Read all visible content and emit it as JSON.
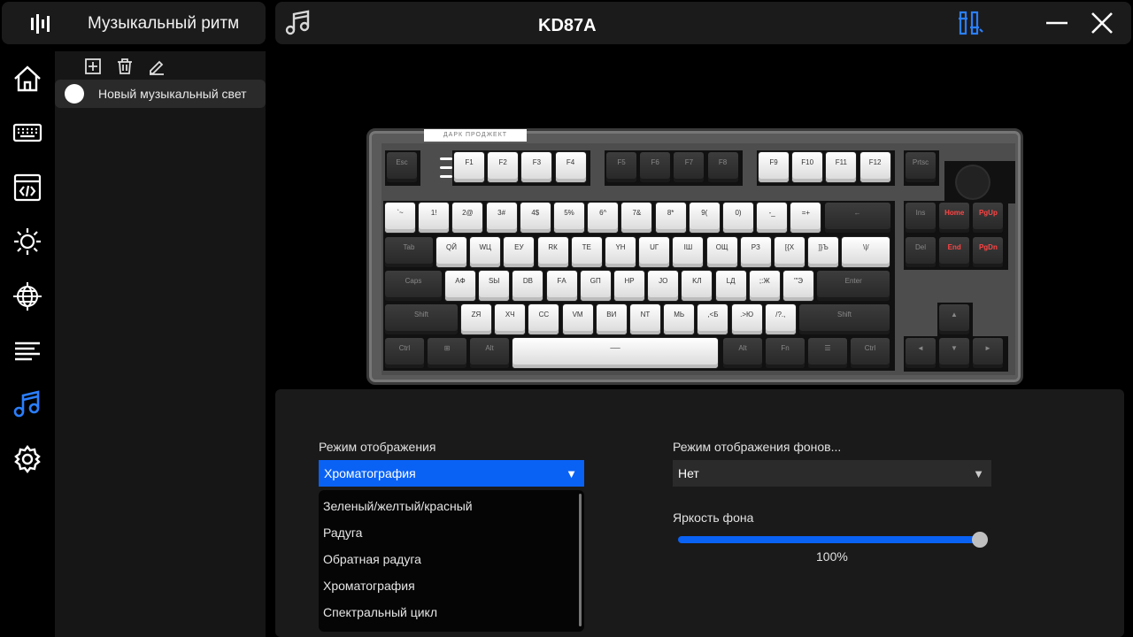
{
  "app": {
    "title": "Музыкальный ритм"
  },
  "header": {
    "device": "KD87A"
  },
  "nav": [
    {
      "icon": "home-icon"
    },
    {
      "icon": "keyboard-icon"
    },
    {
      "icon": "macro-code-icon"
    },
    {
      "icon": "lighting-icon"
    },
    {
      "icon": "globe-icon"
    },
    {
      "icon": "align-lines-icon"
    },
    {
      "icon": "music-notes-icon",
      "active": true
    },
    {
      "icon": "gear-icon"
    }
  ],
  "list": {
    "tools": [
      "add-icon",
      "trash-icon",
      "edit-icon"
    ],
    "items": [
      {
        "label": "Новый музыкальный свет"
      }
    ]
  },
  "keyboard": {
    "brand": "ДАРК ПРОДЖЕКТ",
    "rows": {
      "fn": [
        "Esc",
        "F1",
        "F2",
        "F3",
        "F4",
        "F5",
        "F6",
        "F7",
        "F8",
        "F9",
        "F10",
        "F11",
        "F12",
        "Prtsc"
      ],
      "num": [
        "`~",
        "1!",
        "2@",
        "3#",
        "4$",
        "5%",
        "6^",
        "7&",
        "8*",
        "9(",
        "0)",
        "-_",
        "=+",
        "←"
      ],
      "q": [
        "Tab",
        "QЙ",
        "WЦ",
        "EУ",
        "RК",
        "TЕ",
        "YН",
        "UГ",
        "IШ",
        "OЩ",
        "PЗ",
        "[{Х",
        "]}Ъ",
        "\\|/"
      ],
      "a": [
        "Caps",
        "AФ",
        "SЫ",
        "DВ",
        "FА",
        "GП",
        "HР",
        "JО",
        "KЛ",
        "LД",
        ";:Ж",
        "'\"Э",
        "Enter"
      ],
      "z": [
        "Shift",
        "ZЯ",
        "XЧ",
        "CС",
        "VМ",
        "BИ",
        "NТ",
        "MЬ",
        ",<Б",
        ".>Ю",
        "/?.,",
        "Shift"
      ],
      "bottom": [
        "Ctrl",
        "⊞",
        "Alt",
        "──",
        "Alt",
        "Fn",
        "☰",
        "Ctrl"
      ],
      "nav1": [
        "Ins",
        "Home",
        "PgUp"
      ],
      "nav2": [
        "Del",
        "End",
        "PgDn"
      ],
      "arrows": [
        "▲",
        "◄",
        "▼",
        "►"
      ]
    }
  },
  "settings": {
    "mode_label": "Режим отображения",
    "mode_value": "Хроматография",
    "bg_mode_label": "Режим отображения фонов...",
    "bg_mode_value": "Нет",
    "brightness_label": "Яркость фона",
    "brightness_value": "100%",
    "brightness_fraction": 1.0,
    "dropdown_options": [
      "Зеленый/желтый/красный",
      "Радуга",
      "Обратная радуга",
      "Хроматография",
      "Спектральный цикл"
    ],
    "accent_color": "#0a62f5"
  }
}
